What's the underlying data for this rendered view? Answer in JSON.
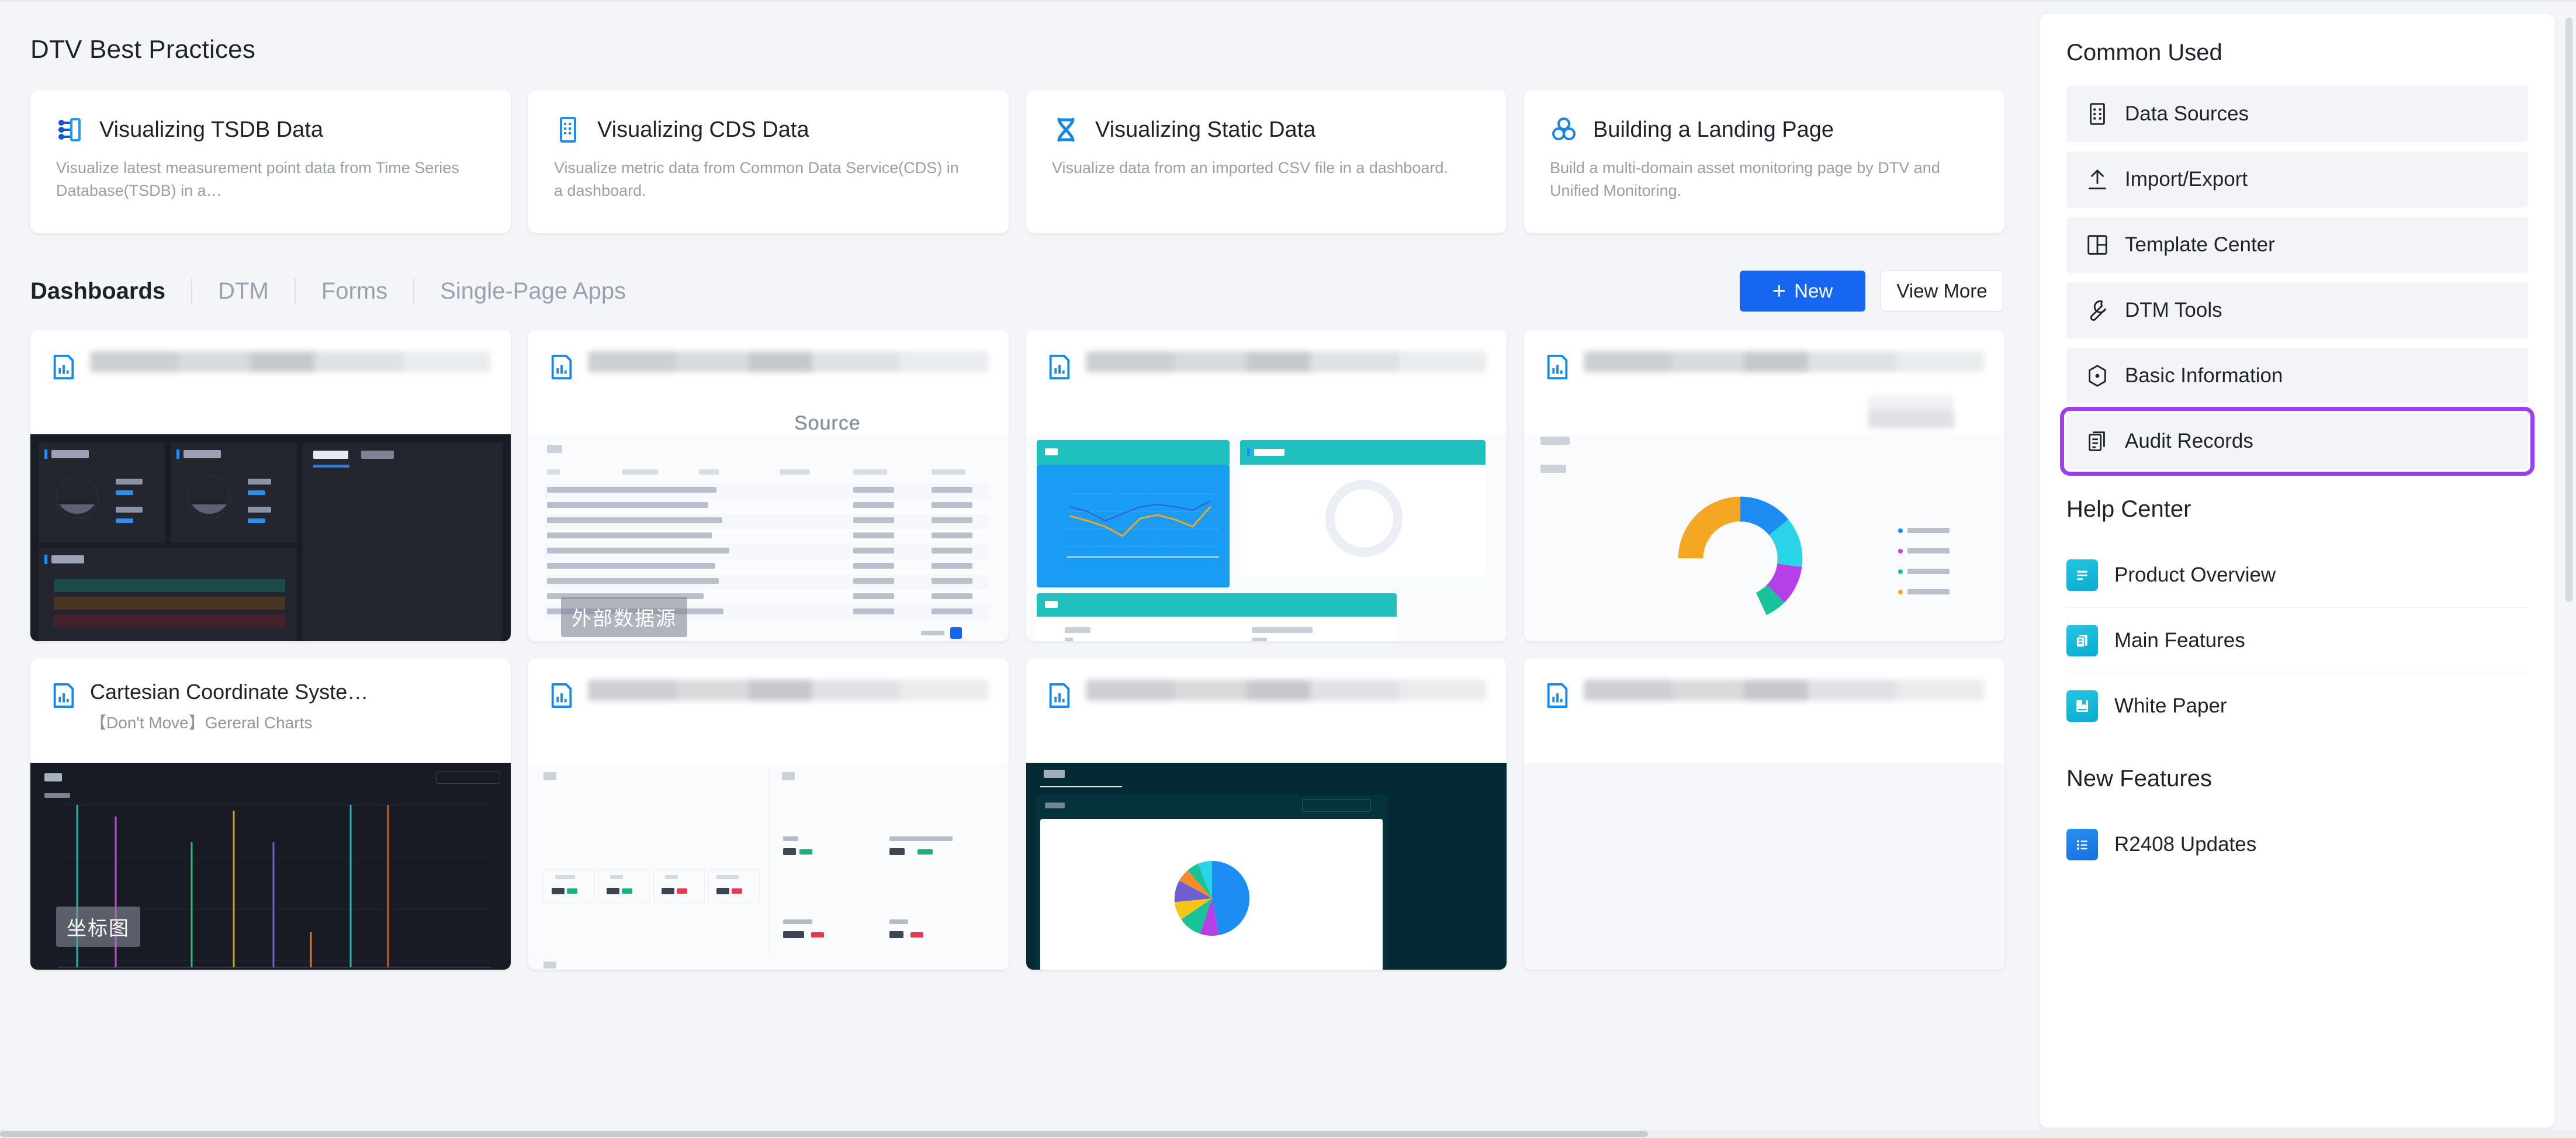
{
  "best_practices": {
    "title": "DTV Best Practices",
    "cards": [
      {
        "icon": "tsdb-icon",
        "title": "Visualizing TSDB Data",
        "desc": "Visualize latest measurement point data from Time Series Database(TSDB) in a…"
      },
      {
        "icon": "cds-table-icon",
        "title": "Visualizing CDS Data",
        "desc": "Visualize metric data from Common Data Service(CDS) in a dashboard."
      },
      {
        "icon": "static-data-icon",
        "title": "Visualizing Static Data",
        "desc": "Visualize data from an imported CSV file in a dashboard."
      },
      {
        "icon": "landing-page-icon",
        "title": "Building a Landing Page",
        "desc": "Build a multi-domain asset monitoring page by DTV and Unified Monitoring."
      }
    ]
  },
  "tabs": {
    "items": [
      {
        "label": "Dashboards",
        "active": true
      },
      {
        "label": "DTM",
        "active": false
      },
      {
        "label": "Forms",
        "active": false
      },
      {
        "label": "Single-Page Apps",
        "active": false
      }
    ],
    "new_label": "New",
    "new_plus": "+",
    "view_more_label": "View More"
  },
  "dashboards": {
    "cards": [
      {
        "title": "",
        "subtitle": "",
        "title_blurred": true,
        "thumb": "dark-gauges",
        "overlay": ""
      },
      {
        "title": "",
        "subtitle": "",
        "title_blurred": true,
        "thumb": "light-table",
        "ghost_word": "Source",
        "overlay": "外部数据源"
      },
      {
        "title": "",
        "subtitle": "",
        "title_blurred": true,
        "thumb": "teal-line-gauge",
        "overlay": ""
      },
      {
        "title": "",
        "subtitle": "",
        "title_blurred": true,
        "thumb": "donut",
        "overlay": ""
      },
      {
        "title": "Cartesian Coordinate Syste…",
        "subtitle": "【Don't Move】Gereral Charts",
        "title_blurred": false,
        "thumb": "dark-sticks",
        "overlay": "坐标图"
      },
      {
        "title": "",
        "subtitle": "",
        "title_blurred": true,
        "thumb": "kpi-cards",
        "overlay": ""
      },
      {
        "title": "",
        "subtitle": "",
        "title_blurred": true,
        "thumb": "dark-pie",
        "overlay": ""
      },
      {
        "title": "",
        "subtitle": "",
        "title_blurred": true,
        "thumb": "empty",
        "overlay": ""
      }
    ]
  },
  "sidebar": {
    "common_used_title": "Common Used",
    "common_used": [
      {
        "label": "Data Sources",
        "icon": "grid-table-icon",
        "highlighted": false
      },
      {
        "label": "Import/Export",
        "icon": "upload-icon",
        "highlighted": false
      },
      {
        "label": "Template Center",
        "icon": "layout-icon",
        "highlighted": false
      },
      {
        "label": "DTM Tools",
        "icon": "wrench-icon",
        "highlighted": false
      },
      {
        "label": "Basic Information",
        "icon": "hexagon-info-icon",
        "highlighted": false
      },
      {
        "label": "Audit Records",
        "icon": "audit-doc-icon",
        "highlighted": true
      }
    ],
    "help_center_title": "Help Center",
    "help_center": [
      {
        "label": "Product Overview",
        "icon": "document-lines-icon",
        "color": "#11b6d8"
      },
      {
        "label": "Main Features",
        "icon": "copy-docs-icon",
        "color": "#11b6d8"
      },
      {
        "label": "White Paper",
        "icon": "book-icon",
        "color": "#11b6d8"
      }
    ],
    "new_features_title": "New Features",
    "new_features": [
      {
        "label": "R2408 Updates",
        "icon": "list-icon",
        "color": "#1d84ef"
      }
    ]
  },
  "colors": {
    "accent_blue": "#1766f2",
    "highlight_purple": "#9b3ff0",
    "page_bg": "#f4f5f8",
    "text_primary": "#1f2329",
    "text_muted": "#9a9ea8"
  }
}
